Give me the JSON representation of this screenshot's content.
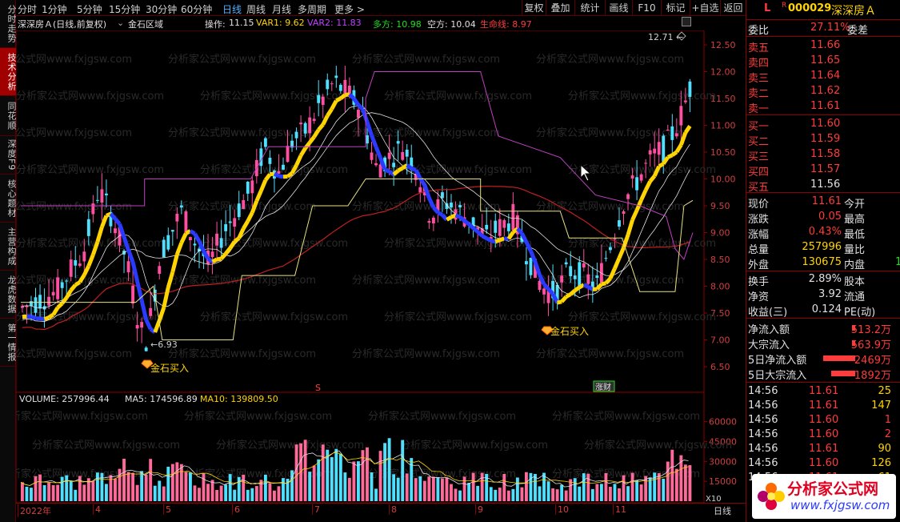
{
  "left_tabs": [
    {
      "label": "分时走势",
      "active": false
    },
    {
      "label": "技术分析",
      "active": true
    },
    {
      "label": "同花顺",
      "active": false
    },
    {
      "label": "深度F9",
      "active": false
    },
    {
      "label": "核心题材",
      "active": false
    },
    {
      "label": "主营构成",
      "active": false
    },
    {
      "label": "龙虎数据",
      "active": false
    },
    {
      "label": "第一情报",
      "active": false
    }
  ],
  "toolbar": {
    "periods": [
      "分时",
      "1分钟",
      "5分钟",
      "15分钟",
      "30分钟",
      "60分钟",
      "日线",
      "周线",
      "月线",
      "多周期",
      "更多 >"
    ],
    "active_period": "日线",
    "buttons": [
      "复权",
      "叠加",
      "统计",
      "画线",
      "F10",
      "标记",
      "+自选",
      "返回"
    ]
  },
  "info": {
    "stock_name": "深深房Ａ(日线,前复权)",
    "indicator": "金石区域",
    "op_label": "操作:",
    "op_value": "11.15",
    "var1": "VAR1: 9.62",
    "var2": "VAR2: 11.83",
    "duo": "多方: 10.98",
    "kong": "空方: 10.04",
    "life": "生命线: 8.97"
  },
  "price_axis": [
    "12.50",
    "12.00",
    "11.50",
    "11.00",
    "10.50",
    "10.00",
    "9.50",
    "9.00",
    "8.50",
    "8.00",
    "7.50",
    "7.00",
    "6.50"
  ],
  "annotations": {
    "high": "12.71",
    "low": "6.93",
    "buy1": "金石买入",
    "buy2": "金石买入",
    "s_mark": "S",
    "event_tag": "涨财"
  },
  "watermark": "分析家公式网www.fxjgsw.com",
  "volume": {
    "label": "VOLUME: 257996.44",
    "ma5": "MA5: 174596.89",
    "ma10": "MA10: 139809.50",
    "axis": [
      "60000",
      "45000",
      "30000",
      "15000"
    ],
    "unit": "X10"
  },
  "time_axis": [
    "2022年",
    "4",
    "5",
    "6",
    "7",
    "8",
    "9",
    "10",
    "11"
  ],
  "period_label": "日线",
  "right": {
    "code": "000029",
    "name": "深深房Ａ",
    "marker_l": "L",
    "marker_r": "R",
    "weibi_label": "委比",
    "weibi_value": "27.11%",
    "weicha_label": "委差",
    "asks": [
      {
        "label": "卖五",
        "price": "11.66"
      },
      {
        "label": "卖四",
        "price": "11.65"
      },
      {
        "label": "卖三",
        "price": "11.64"
      },
      {
        "label": "卖二",
        "price": "11.62"
      },
      {
        "label": "卖一",
        "price": "11.61"
      }
    ],
    "bids": [
      {
        "label": "买一",
        "price": "11.60"
      },
      {
        "label": "买二",
        "price": "11.59"
      },
      {
        "label": "买三",
        "price": "11.58"
      },
      {
        "label": "买四",
        "price": "11.57"
      },
      {
        "label": "买五",
        "price": "11.56"
      }
    ],
    "quote": [
      {
        "l": "现价",
        "v": "11.61",
        "l2": "今开",
        "v2": ""
      },
      {
        "l": "涨跌",
        "v": "0.05",
        "l2": "最高",
        "v2": ""
      },
      {
        "l": "涨幅",
        "v": "0.43%",
        "l2": "最低",
        "v2": ""
      },
      {
        "l": "总量",
        "v": "257996",
        "l2": "量比",
        "v2": ""
      },
      {
        "l": "外盘",
        "v": "130675",
        "l2": "内盘",
        "v2": "1"
      }
    ],
    "fund": [
      {
        "l": "换手",
        "v": "2.89%",
        "l2": "股本"
      },
      {
        "l": "净资",
        "v": "3.92",
        "l2": "流通"
      },
      {
        "l": "收益(三)",
        "v": "0.124",
        "l2": "PE(动)"
      }
    ],
    "flows": [
      {
        "l": "净流入额",
        "v": "513.2万"
      },
      {
        "l": "大宗流入",
        "v": "563.9万"
      },
      {
        "l": "5日净流入额",
        "v": "2469万"
      },
      {
        "l": "5日大宗流入",
        "v": "1892万"
      }
    ],
    "ticks": [
      {
        "t": "14:56",
        "p": "11.61",
        "v": "25"
      },
      {
        "t": "14:56",
        "p": "11.61",
        "v": "147"
      },
      {
        "t": "14:56",
        "p": "11.60",
        "v": "1"
      },
      {
        "t": "14:56",
        "p": "11.60",
        "v": "2"
      },
      {
        "t": "14:56",
        "p": "11.61",
        "v": "90"
      },
      {
        "t": "14:56",
        "p": "11.60",
        "v": "126"
      },
      {
        "t": "14:56",
        "p": "11.61",
        "v": "61"
      }
    ]
  },
  "logo": {
    "text": "分析家公式网",
    "url": "www.fxjgsw.com"
  },
  "colors": {
    "up": "#ff3b3b",
    "down": "#4fe0ff",
    "yellow": "#ffd400",
    "magenta": "#c040c0",
    "blue": "#2a3bff"
  }
}
